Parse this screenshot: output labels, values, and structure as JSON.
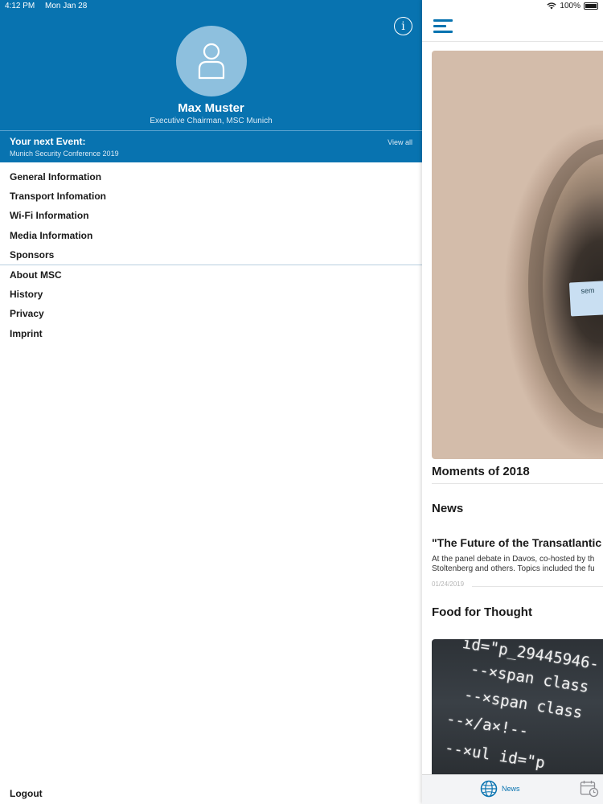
{
  "status_bar": {
    "time": "4:12 PM",
    "date": "Mon Jan 28",
    "battery": "100%"
  },
  "profile": {
    "name": "Max Muster",
    "role": "Executive Chairman, MSC Munich"
  },
  "next_event": {
    "title": "Your next Event:",
    "name": "Munich Security Conference 2019",
    "view_all": "View all"
  },
  "menu": {
    "group1": [
      {
        "label": "General Information"
      },
      {
        "label": "Transport Infomation"
      },
      {
        "label": "Wi-Fi Information"
      },
      {
        "label": "Media Information"
      },
      {
        "label": "Sponsors"
      }
    ],
    "group2": [
      {
        "label": "About MSC"
      },
      {
        "label": "History"
      },
      {
        "label": "Privacy"
      },
      {
        "label": "Imprint"
      }
    ],
    "logout": "Logout"
  },
  "content": {
    "hero_caption": "Moments of 2018",
    "hero_card_text": "sem",
    "news_header": "News",
    "article": {
      "title": "\"The Future of the Transatlantic",
      "body": "At the panel debate in Davos, co-hosted by th Stoltenberg and others. Topics included the fu",
      "date": "01/24/2019"
    },
    "food_header": "Food for Thought",
    "code_lines": [
      "id=\"p_29445946-",
      "--×span class",
      "--×span class",
      "--×/a×!--",
      "--×ul id=\"p"
    ]
  },
  "tabbar": {
    "news_label": "News"
  },
  "colors": {
    "brand": "#0873b0",
    "avatar_bg": "#8ec0de"
  },
  "icons": [
    "info-icon",
    "user-icon",
    "hamburger-menu-icon",
    "wifi-icon",
    "battery-icon",
    "globe-icon",
    "calendar-clock-icon"
  ]
}
